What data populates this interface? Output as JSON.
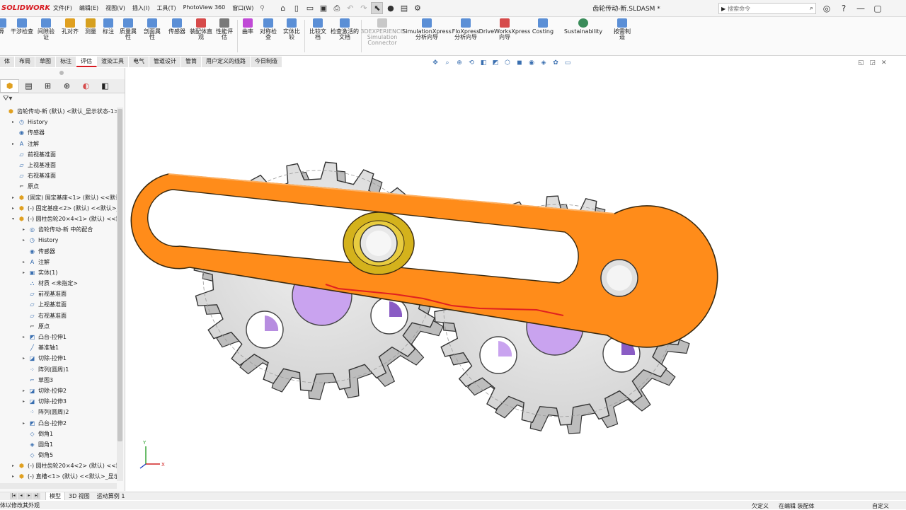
{
  "app": {
    "logo": "SOLIDWORKS",
    "doc_title": "齿轮传动-新.SLDASM *"
  },
  "menu": [
    "文件(F)",
    "编辑(E)",
    "视图(V)",
    "插入(I)",
    "工具(T)",
    "PhotoView 360",
    "窗口(W)"
  ],
  "search": {
    "placeholder": "搜索命令"
  },
  "ribbon": [
    {
      "label": "干涉检查",
      "color": "#5b8fd6"
    },
    {
      "label": "间隙验证",
      "color": "#5b8fd6"
    },
    {
      "label": "孔对齐",
      "color": "#e0a020"
    },
    {
      "label": "测量",
      "color": "#d6a020"
    },
    {
      "label": "标注",
      "color": "#5b8fd6"
    },
    {
      "label": "质量属性",
      "color": "#5b8fd6"
    },
    {
      "label": "剖面属性",
      "color": "#5b8fd6"
    },
    {
      "label": "传感器",
      "color": "#5b8fd6"
    },
    {
      "label": "装配体直观",
      "color": "#d64a4a"
    },
    {
      "label": "性能评估",
      "color": "#7a7a7a"
    },
    {
      "label": "曲率",
      "color": "#c04ad6"
    },
    {
      "label": "对称检查",
      "color": "#5b8fd6"
    },
    {
      "label": "实体比较",
      "color": "#5b8fd6"
    },
    {
      "label": "比较文档",
      "color": "#5b8fd6"
    },
    {
      "label": "检查激活的文档",
      "color": "#5b8fd6"
    },
    {
      "label": "3DEXPERIENCE Simulation Connector",
      "color": "#b0b0b0"
    },
    {
      "label": "SimulationXpress 分析向导",
      "color": "#5b8fd6"
    },
    {
      "label": "FloXpress 分析向导",
      "color": "#5b8fd6"
    },
    {
      "label": "DriveWorksXpress 向导",
      "color": "#d64a4a"
    },
    {
      "label": "Costing",
      "color": "#5b8fd6"
    },
    {
      "label": "Sustainability",
      "color": "#3a8c5a"
    },
    {
      "label": "按需制造",
      "color": "#5b8fd6"
    }
  ],
  "tabs": [
    "体",
    "布局",
    "草图",
    "标注",
    "评估",
    "渲染工具",
    "电气",
    "管道设计",
    "管筒",
    "用户定义的线路",
    "今日制造"
  ],
  "active_tab": "评估",
  "tree": [
    {
      "label": "齿轮传动-新 (默认) <默认_显示状态-1>",
      "level": 0,
      "exp": "",
      "icon": "asm-icon"
    },
    {
      "label": "History",
      "level": 1,
      "exp": "▸",
      "icon": "history-icon"
    },
    {
      "label": "传感器",
      "level": 1,
      "exp": "",
      "icon": "sensor-icon"
    },
    {
      "label": "注解",
      "level": 1,
      "exp": "▸",
      "icon": "annotation-icon"
    },
    {
      "label": "前视基准面",
      "level": 1,
      "exp": "",
      "icon": "plane-icon"
    },
    {
      "label": "上视基准面",
      "level": 1,
      "exp": "",
      "icon": "plane-icon"
    },
    {
      "label": "右视基准面",
      "level": 1,
      "exp": "",
      "icon": "plane-icon"
    },
    {
      "label": "原点",
      "level": 1,
      "exp": "",
      "icon": "origin-icon"
    },
    {
      "label": "(固定) 固定基座<1> (默认) <<默认",
      "level": 1,
      "exp": "▸",
      "icon": "part-icon"
    },
    {
      "label": "(-) 固定基座<2> (默认) <<默认>_",
      "level": 1,
      "exp": "▸",
      "icon": "part-icon"
    },
    {
      "label": "(-) 圆柱齿轮20×4<1> (默认) <<默",
      "level": 1,
      "exp": "▾",
      "icon": "part-icon"
    },
    {
      "label": "齿轮传动-新 中的配合",
      "level": 2,
      "exp": "▸",
      "icon": "mate-icon"
    },
    {
      "label": "History",
      "level": 2,
      "exp": "▸",
      "icon": "history-icon"
    },
    {
      "label": "传感器",
      "level": 2,
      "exp": "",
      "icon": "sensor-icon"
    },
    {
      "label": "注解",
      "level": 2,
      "exp": "▸",
      "icon": "annotation-icon"
    },
    {
      "label": "实体(1)",
      "level": 2,
      "exp": "▸",
      "icon": "solid-icon"
    },
    {
      "label": "材质 <未指定>",
      "level": 2,
      "exp": "",
      "icon": "material-icon"
    },
    {
      "label": "前视基准面",
      "level": 2,
      "exp": "",
      "icon": "plane-icon"
    },
    {
      "label": "上视基准面",
      "level": 2,
      "exp": "",
      "icon": "plane-icon"
    },
    {
      "label": "右视基准面",
      "level": 2,
      "exp": "",
      "icon": "plane-icon"
    },
    {
      "label": "原点",
      "level": 2,
      "exp": "",
      "icon": "origin-icon"
    },
    {
      "label": "凸台-拉伸1",
      "level": 2,
      "exp": "▸",
      "icon": "boss-icon"
    },
    {
      "label": "基准轴1",
      "level": 2,
      "exp": "",
      "icon": "axis-icon"
    },
    {
      "label": "切除-拉伸1",
      "level": 2,
      "exp": "▸",
      "icon": "cut-icon"
    },
    {
      "label": "阵列(圆周)1",
      "level": 2,
      "exp": "",
      "icon": "pattern-icon"
    },
    {
      "label": "草图3",
      "level": 2,
      "exp": "",
      "icon": "sketch-icon"
    },
    {
      "label": "切除-拉伸2",
      "level": 2,
      "exp": "▸",
      "icon": "cut-icon"
    },
    {
      "label": "切除-拉伸3",
      "level": 2,
      "exp": "▸",
      "icon": "cut-icon"
    },
    {
      "label": "阵列(圆周)2",
      "level": 2,
      "exp": "",
      "icon": "pattern-icon"
    },
    {
      "label": "凸台-拉伸2",
      "level": 2,
      "exp": "▸",
      "icon": "boss-icon"
    },
    {
      "label": "倒角1",
      "level": 2,
      "exp": "",
      "icon": "chamfer-icon"
    },
    {
      "label": "圆角1",
      "level": 2,
      "exp": "",
      "icon": "fillet-icon"
    },
    {
      "label": "倒角5",
      "level": 2,
      "exp": "",
      "icon": "chamfer-icon"
    },
    {
      "label": "(-) 圆柱齿轮20×4<2> (默认) <<默",
      "level": 1,
      "exp": "▸",
      "icon": "part-icon"
    },
    {
      "label": "(-) 直槽<1> (默认) <<默认>_显示",
      "level": 1,
      "exp": "▸",
      "icon": "part-icon"
    }
  ],
  "bottom_tabs": [
    "模型",
    "3D 视图",
    "运动算例 1"
  ],
  "status": {
    "message": "体以修改其外观",
    "right1": "欠定义",
    "right2": "在编辑 装配体",
    "right3": "自定义"
  },
  "colors": {
    "accent": "#d71920",
    "link_orange": "#ff8c1a",
    "gear_gray": "#e4e4e4",
    "hole_purple": "#c9a3ef",
    "bushing_gold": "#d4b21c",
    "sketch_red": "#e02020"
  }
}
